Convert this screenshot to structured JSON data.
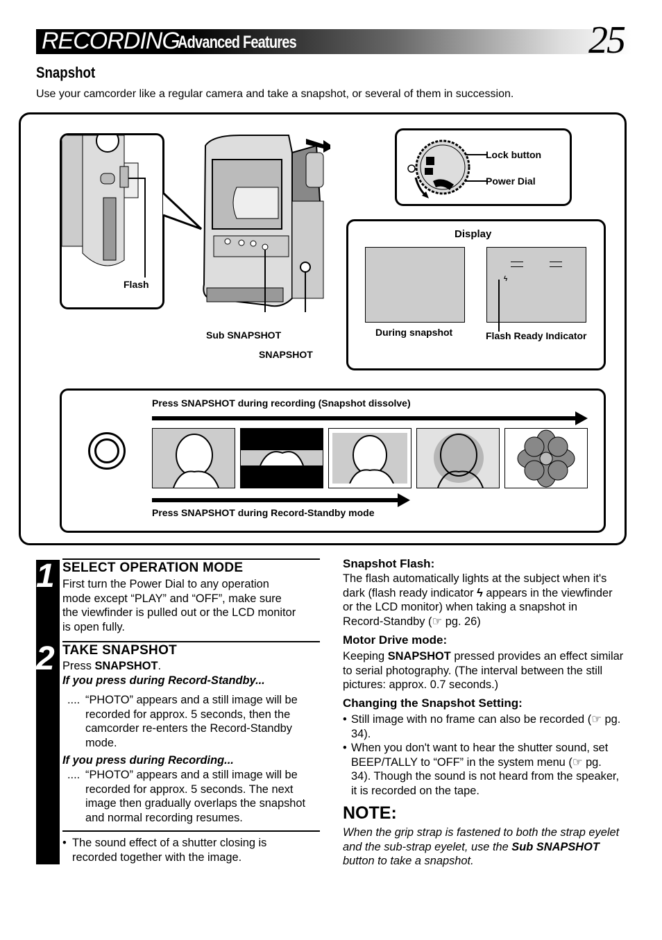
{
  "header": {
    "title": "RECORDING",
    "subtitle": "Advanced Features",
    "page_number": "25"
  },
  "section": {
    "title": "Snapshot",
    "intro": "Use your camcorder like a regular camera and take a snapshot, or several of them in succession."
  },
  "figure": {
    "flash_label": "Flash",
    "sub_snapshot_label": "Sub SNAPSHOT",
    "snapshot_label": "SNAPSHOT",
    "lock_button_label": "Lock button",
    "power_dial_label": "Power Dial",
    "display_title": "Display",
    "during_snapshot_label": "During snapshot",
    "flash_ready_label": "Flash Ready Indicator",
    "flash_ready_glyph": "ϟ",
    "dissolve_label": "Press SNAPSHOT during recording (Snapshot dissolve)",
    "standby_label": "Press SNAPSHOT during Record-Standby mode",
    "frames": [
      "portrait",
      "portrait-letterbox",
      "portrait-framed",
      "portrait-flower-overlap",
      "flower"
    ]
  },
  "steps": [
    {
      "number": "1",
      "heading": "SELECT OPERATION MODE",
      "text": "First turn the Power Dial to any operation mode except “PLAY” and “OFF”, make sure the viewfinder is pulled out or the LCD monitor is open fully."
    },
    {
      "number": "2",
      "heading": "TAKE SNAPSHOT",
      "press_prefix": "Press ",
      "press_bold": "SNAPSHOT",
      "press_suffix": ".",
      "case1_heading": "If you press during Record-Standby...",
      "case1_dots": "....",
      "case1_text": "“PHOTO” appears and a still image will be recorded for approx. 5 seconds, then the camcorder re-enters the Record-Standby mode.",
      "case2_heading": "If you press during Recording...",
      "case2_dots": "....",
      "case2_text": "“PHOTO” appears and a still image will be recorded for approx. 5 seconds. The next image then gradually overlaps the snapshot and normal recording resumes."
    }
  ],
  "footnote": "The sound effect of a shutter closing is recorded together with the image.",
  "right": {
    "flash_heading": "Snapshot Flash:",
    "flash_text_1": "The flash automatically lights at the subject when it's dark (flash ready indicator ",
    "flash_glyph": "ϟ",
    "flash_text_2": " appears in the viewfinder or the LCD monitor) when taking a snapshot in Record-Standby (",
    "ref_glyph": "☞",
    "flash_text_3": " pg. 26)",
    "motor_heading": "Motor Drive mode:",
    "motor_text_1": "Keeping ",
    "motor_bold": "SNAPSHOT",
    "motor_text_2": " pressed provides an effect similar to serial photography. (The interval between the still pictures: approx. 0.7 seconds.)",
    "changing_heading": "Changing the Snapshot Setting:",
    "bullet1_a": "Still image with no frame can also be recorded (",
    "bullet1_b": " pg. 34).",
    "bullet2_a": "When you don't want to hear the shutter sound, set BEEP/TALLY to “OFF” in the system menu (",
    "bullet2_b": " pg. 34). Though the sound is not heard from the speaker, it is recorded on the tape.",
    "note_heading": "NOTE:",
    "note_text_1": "When the grip strap is fastened to both the strap eyelet and the sub-strap eyelet, use the ",
    "note_bold": "Sub SNAPSHOT",
    "note_text_2": "  button to take a snapshot."
  }
}
